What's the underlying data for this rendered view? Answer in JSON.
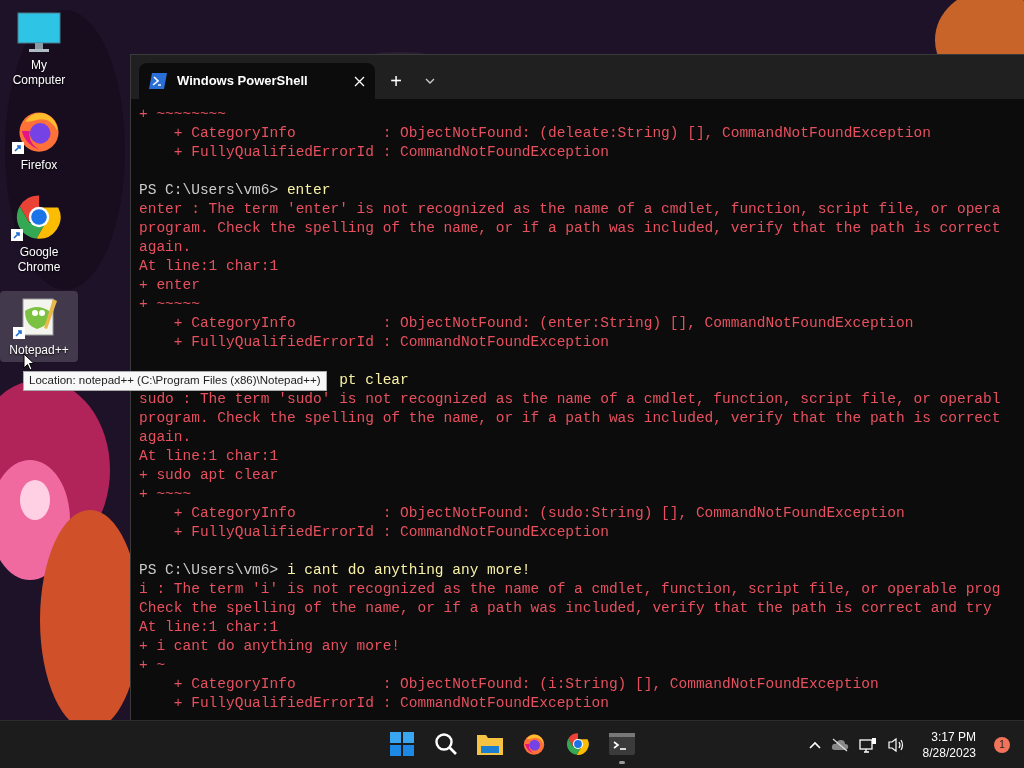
{
  "desktop_icons": [
    {
      "label": "My Computer",
      "kind": "monitor",
      "selected": false
    },
    {
      "label": "Firefox",
      "kind": "firefox",
      "selected": false
    },
    {
      "label": "Google Chrome",
      "kind": "chrome",
      "selected": false
    },
    {
      "label": "Notepad++",
      "kind": "notepad",
      "selected": true
    }
  ],
  "tooltip": {
    "text": "Location: notepad++ (C:\\Program Files (x86)\\Notepad++)"
  },
  "window": {
    "tabs": [
      {
        "title": "Windows PowerShell",
        "selected": true
      }
    ],
    "new_tab": "+"
  },
  "terminal": {
    "lines": [
      {
        "kind": "error",
        "text": "+ ~~~~~~~~"
      },
      {
        "kind": "error",
        "text": "    + CategoryInfo          : ObjectNotFound: (deleate:String) [], CommandNotFoundException"
      },
      {
        "kind": "error",
        "text": "    + FullyQualifiedErrorId : CommandNotFoundException"
      },
      {
        "kind": "blank"
      },
      {
        "kind": "prompt",
        "prompt": "PS C:\\Users\\vm6>",
        "command": "enter"
      },
      {
        "kind": "error",
        "text": "enter : The term 'enter' is not recognized as the name of a cmdlet, function, script file, or opera"
      },
      {
        "kind": "error",
        "text": "program. Check the spelling of the name, or if a path was included, verify that the path is correct"
      },
      {
        "kind": "error",
        "text": "again."
      },
      {
        "kind": "error",
        "text": "At line:1 char:1"
      },
      {
        "kind": "error",
        "text": "+ enter"
      },
      {
        "kind": "error",
        "text": "+ ~~~~~"
      },
      {
        "kind": "error",
        "text": "    + CategoryInfo          : ObjectNotFound: (enter:String) [], CommandNotFoundException"
      },
      {
        "kind": "error",
        "text": "    + FullyQualifiedErrorId : CommandNotFoundException"
      },
      {
        "kind": "blank"
      },
      {
        "kind": "covered",
        "command": "pt clear"
      },
      {
        "kind": "error",
        "text": "sudo : The term 'sudo' is not recognized as the name of a cmdlet, function, script file, or operabl"
      },
      {
        "kind": "error",
        "text": "program. Check the spelling of the name, or if a path was included, verify that the path is correct"
      },
      {
        "kind": "error",
        "text": "again."
      },
      {
        "kind": "error",
        "text": "At line:1 char:1"
      },
      {
        "kind": "error",
        "text": "+ sudo apt clear"
      },
      {
        "kind": "error",
        "text": "+ ~~~~"
      },
      {
        "kind": "error",
        "text": "    + CategoryInfo          : ObjectNotFound: (sudo:String) [], CommandNotFoundException"
      },
      {
        "kind": "error",
        "text": "    + FullyQualifiedErrorId : CommandNotFoundException"
      },
      {
        "kind": "blank"
      },
      {
        "kind": "prompt",
        "prompt": "PS C:\\Users\\vm6>",
        "command": "i cant do anything any more!"
      },
      {
        "kind": "error",
        "text": "i : The term 'i' is not recognized as the name of a cmdlet, function, script file, or operable prog"
      },
      {
        "kind": "error",
        "text": "Check the spelling of the name, or if a path was included, verify that the path is correct and try"
      },
      {
        "kind": "error",
        "text": "At line:1 char:1"
      },
      {
        "kind": "error",
        "text": "+ i cant do anything any more!"
      },
      {
        "kind": "error",
        "text": "+ ~"
      },
      {
        "kind": "error",
        "text": "    + CategoryInfo          : ObjectNotFound: (i:String) [], CommandNotFoundException"
      },
      {
        "kind": "error",
        "text": "    + FullyQualifiedErrorId : CommandNotFoundException"
      }
    ]
  },
  "taskbar": {
    "apps": [
      {
        "kind": "start",
        "selected": false
      },
      {
        "kind": "search",
        "selected": false
      },
      {
        "kind": "folder",
        "selected": false
      },
      {
        "kind": "firefox",
        "selected": false
      },
      {
        "kind": "chrome",
        "selected": false
      },
      {
        "kind": "terminal",
        "selected": true
      }
    ],
    "clock": {
      "time": "3:17 PM",
      "date": "8/28/2023"
    },
    "notifications": "1"
  }
}
